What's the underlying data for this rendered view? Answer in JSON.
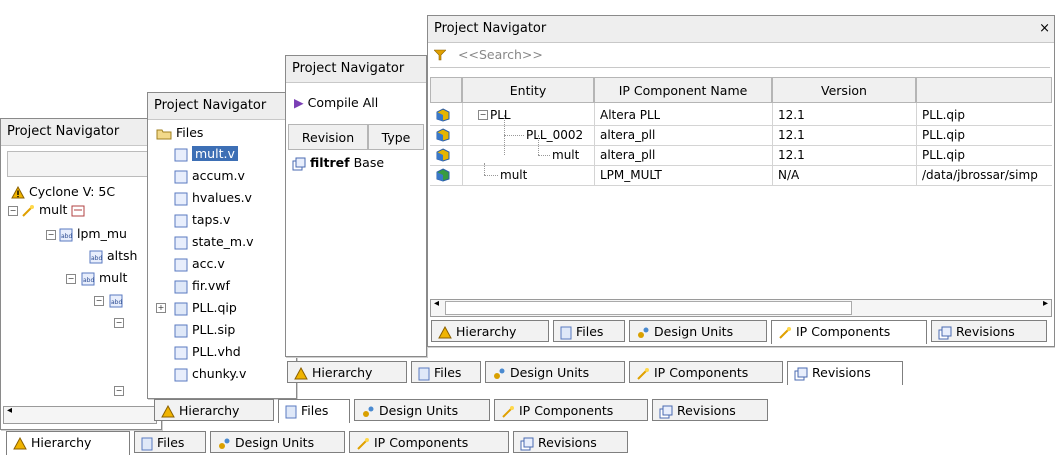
{
  "panel1": {
    "title": "Project Navigator",
    "header_item": "Cyclone V: 5C",
    "tree": [
      "mult",
      "lpm_mu",
      "altsh",
      "mult"
    ],
    "tabs": [
      "Hierarchy",
      "Files",
      "Design Units",
      "IP Components",
      "Revisions"
    ]
  },
  "panel2": {
    "title": "Project Navigator",
    "root": "Files",
    "files": [
      "mult.v",
      "accum.v",
      "hvalues.v",
      "taps.v",
      "state_m.v",
      "acc.v",
      "fir.vwf",
      "PLL.qip",
      "PLL.sip",
      "PLL.vhd",
      "chunky.v"
    ],
    "tabs": [
      "Hierarchy",
      "Files",
      "Design Units",
      "IP Components",
      "Revisions"
    ]
  },
  "panel3": {
    "title": "Project Navigator",
    "compile_label": "Compile All",
    "columns": [
      "Revision",
      "Type"
    ],
    "row": {
      "revision": "filtref",
      "type": "Base"
    },
    "tabs": [
      "Hierarchy",
      "Files",
      "Design Units",
      "IP Components",
      "Revisions"
    ]
  },
  "panel4": {
    "title": "Project Navigator",
    "close": "×",
    "search_placeholder": "<<Search>>",
    "columns": [
      "Entity",
      "IP Component Name",
      "Version"
    ],
    "rows": [
      {
        "entity": "PLL",
        "ip": "Altera PLL",
        "version": "12.1",
        "file": "PLL.qip"
      },
      {
        "entity": "PLL_0002",
        "ip": "altera_pll",
        "version": "12.1",
        "file": "PLL.qip"
      },
      {
        "entity": "mult",
        "ip": "altera_pll",
        "version": "12.1",
        "file": "PLL.qip"
      },
      {
        "entity": "mult",
        "ip": "LPM_MULT",
        "version": "N/A",
        "file": "/data/jbrossar/simp"
      }
    ],
    "tabs": [
      "Hierarchy",
      "Files",
      "Design Units",
      "IP Components",
      "Revisions"
    ]
  }
}
